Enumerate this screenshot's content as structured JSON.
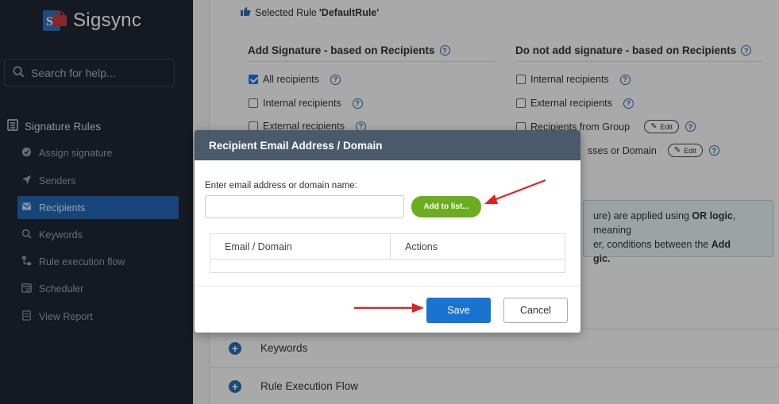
{
  "brand": {
    "name": "Sigsync",
    "logo_letter": "S"
  },
  "search": {
    "placeholder": "Search for help..."
  },
  "nav": {
    "section_label": "Signature Rules",
    "items": [
      {
        "label": "Assign signature",
        "icon": "check-circle-icon"
      },
      {
        "label": "Senders",
        "icon": "paper-plane-icon"
      },
      {
        "label": "Recipients",
        "icon": "envelope-icon",
        "active": true
      },
      {
        "label": "Keywords",
        "icon": "search-icon"
      },
      {
        "label": "Rule execution flow",
        "icon": "flow-icon"
      },
      {
        "label": "Scheduler",
        "icon": "calendar-icon"
      },
      {
        "label": "View Report",
        "icon": "report-icon"
      }
    ]
  },
  "selected_rule": {
    "prefix": "Selected Rule",
    "name": "'DefaultRule'"
  },
  "add_col": {
    "title": "Add Signature - based on Recipients",
    "options": [
      {
        "label": "All recipients",
        "checked": true
      },
      {
        "label": "Internal recipients",
        "checked": false
      },
      {
        "label": "External recipients",
        "checked": false
      }
    ]
  },
  "not_col": {
    "title": "Do not add signature - based on Recipients",
    "options": [
      {
        "label": "Internal recipients"
      },
      {
        "label": "External recipients"
      },
      {
        "label": "Recipients from Group",
        "edit": "Edit"
      },
      {
        "label": "sses or Domain",
        "edit": "Edit"
      }
    ]
  },
  "info": {
    "line1_pre": "ure) are applied using ",
    "line1_bold": "OR logic",
    "line1_post": ", meaning",
    "line2_pre": "er, conditions between the ",
    "line2_bold": "Add",
    "line3_bold": "gic."
  },
  "accordions": [
    "Keywords",
    "Rule Execution Flow"
  ],
  "modal": {
    "title": "Recipient Email Address / Domain",
    "field_label": "Enter email address or domain name:",
    "input_value": "",
    "add_button": "Add to list...",
    "table_headers": [
      "Email / Domain",
      "Actions"
    ],
    "save": "Save",
    "cancel": "Cancel"
  },
  "colors": {
    "sidebar": "#1e2533",
    "active": "#1f66b5",
    "save": "#1a73d1",
    "add": "#6bad1f",
    "arrow": "#e02020"
  }
}
